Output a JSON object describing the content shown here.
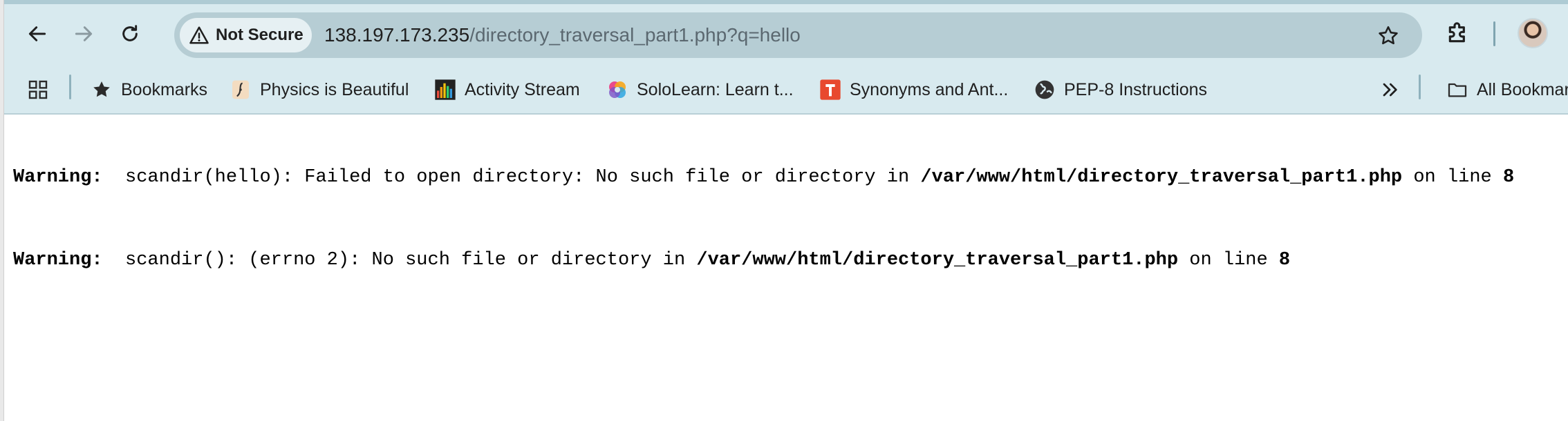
{
  "toolbar": {
    "back_icon": "arrow-left-icon",
    "forward_icon": "arrow-right-icon",
    "reload_icon": "reload-icon"
  },
  "omnibox": {
    "security_label": "Not Secure",
    "url_host": "138.197.173.235",
    "url_path": "/directory_traversal_part1.php?q=hello"
  },
  "bookmarks": {
    "items": [
      {
        "label": "Bookmarks",
        "icon": "star-icon"
      },
      {
        "label": "Physics is Beautiful",
        "icon": "physics-favicon"
      },
      {
        "label": "Activity Stream",
        "icon": "bar-chart-favicon"
      },
      {
        "label": "SoloLearn: Learn t...",
        "icon": "sololearn-favicon"
      },
      {
        "label": "Synonyms and Ant...",
        "icon": "thesaurus-favicon"
      },
      {
        "label": "PEP-8 Instructions",
        "icon": "globe-icon"
      }
    ],
    "overflow_icon": "double-chevron-right-icon",
    "all_bookmarks": "All Bookmarks"
  },
  "page": {
    "warnings": [
      {
        "label": "Warning",
        "message": "scandir(hello): Failed to open directory: No such file or directory in ",
        "file": "/var/www/html/directory_traversal_part1.php",
        "on_line": " on line ",
        "line": "8"
      },
      {
        "label": "Warning",
        "message": "scandir(): (errno 2): No such file or directory in ",
        "file": "/var/www/html/directory_traversal_part1.php",
        "on_line": " on line ",
        "line": "8"
      }
    ]
  },
  "colors": {
    "toolbar_bg": "#d8eaef",
    "omnibox_bg": "#b6cdd4",
    "text": "#1f1f1f"
  }
}
